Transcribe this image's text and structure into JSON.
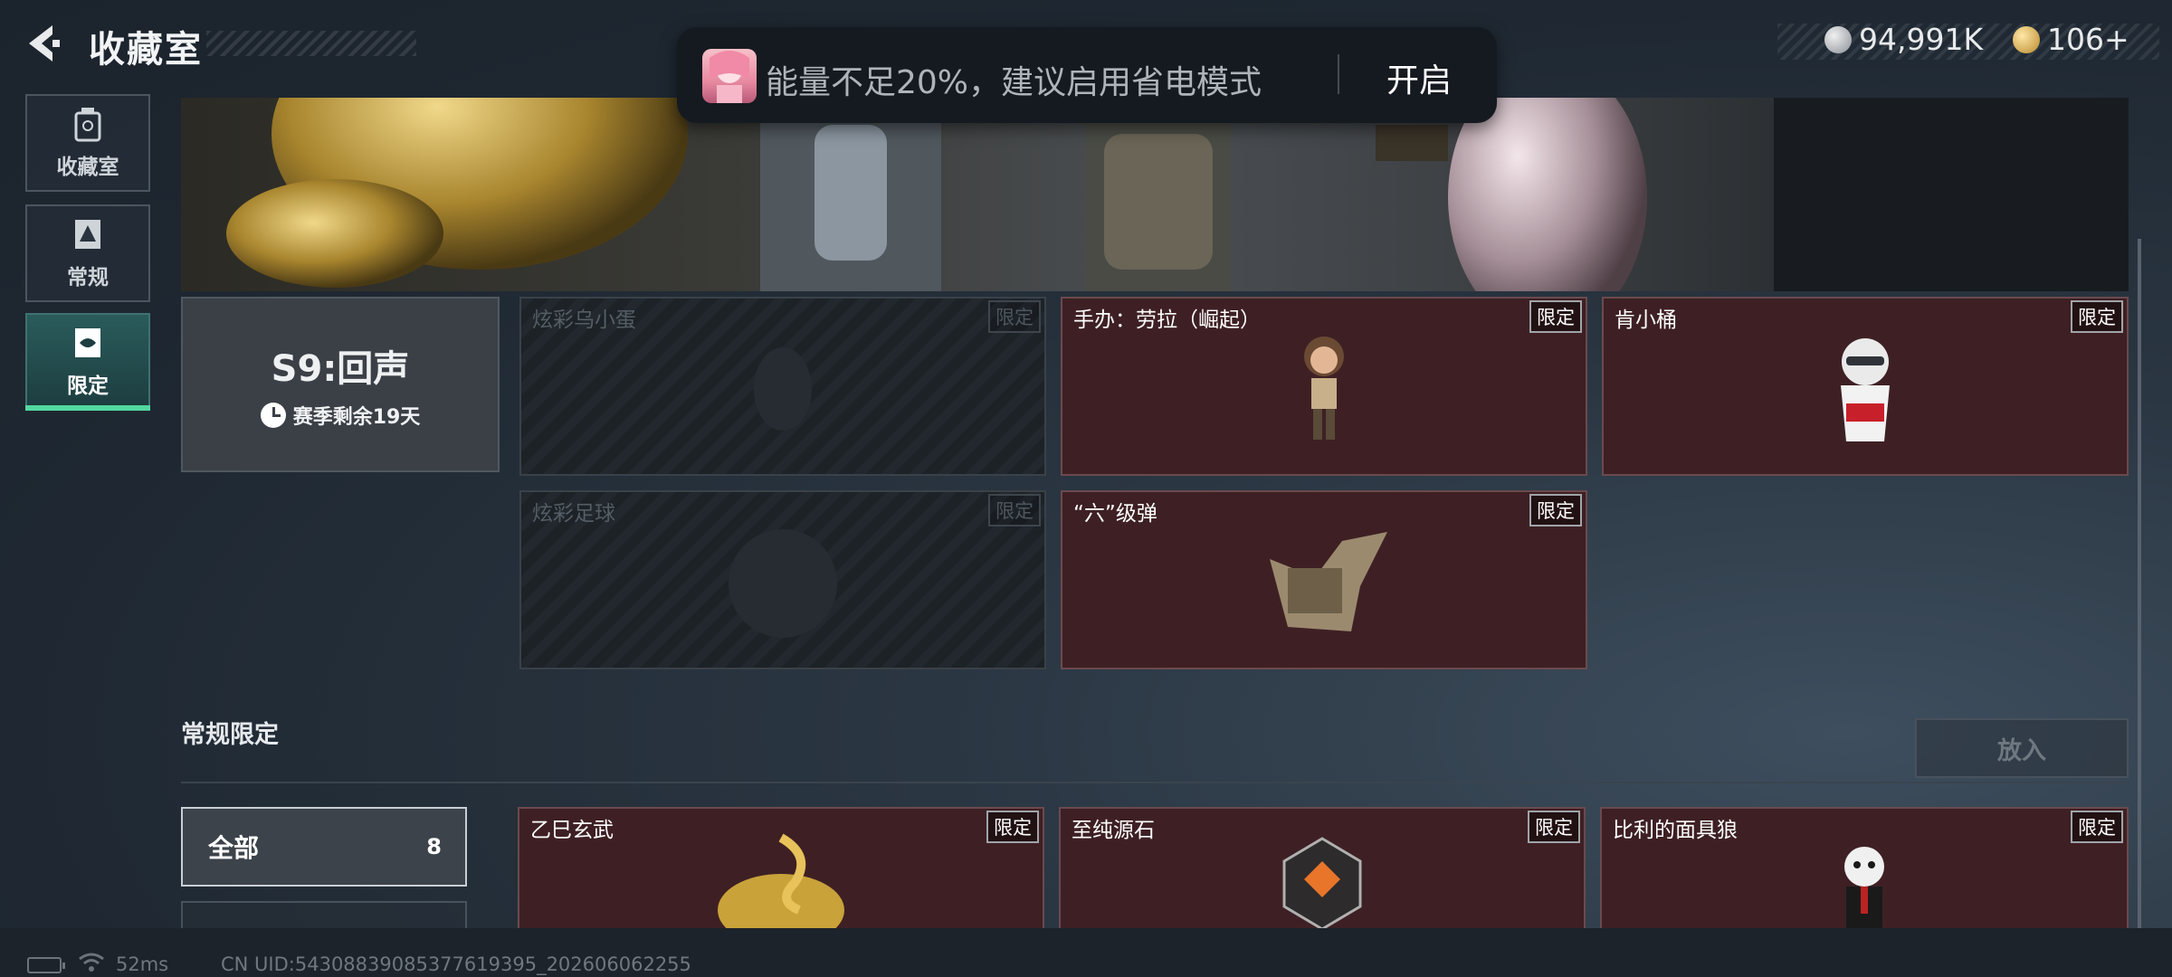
{
  "header": {
    "title": "收藏室",
    "currencies": [
      {
        "icon": "silver-coin-icon",
        "value": "94,991K"
      },
      {
        "icon": "gold-coin-icon",
        "value": "106+"
      }
    ]
  },
  "toast": {
    "message": "能量不足20%，建议启用省电模式",
    "action": "开启"
  },
  "sidebar": {
    "items": [
      {
        "label": "收藏室",
        "icon": "trash-bin-icon",
        "active": false
      },
      {
        "label": "常规",
        "icon": "document-icon",
        "active": false
      },
      {
        "label": "限定",
        "icon": "tag-icon",
        "active": true
      }
    ]
  },
  "season": {
    "title": "S9:回声",
    "remaining": "赛季剩余19天"
  },
  "limited_items": [
    {
      "name": "炫彩乌小蛋",
      "tag": "限定",
      "locked": true
    },
    {
      "name": "手办：劳拉（崛起）",
      "tag": "限定",
      "locked": false
    },
    {
      "name": "肯小桶",
      "tag": "限定",
      "locked": false
    },
    {
      "name": "炫彩足球",
      "tag": "限定",
      "locked": true
    },
    {
      "name": "“六”级弹",
      "tag": "限定",
      "locked": false
    }
  ],
  "regular_section": {
    "title": "常规限定",
    "put_button": "放入",
    "filters": [
      {
        "label": "全部",
        "count": "8"
      }
    ],
    "items": [
      {
        "name": "乙巳玄武",
        "tag": "限定"
      },
      {
        "name": "至纯源石",
        "tag": "限定"
      },
      {
        "name": "比利的面具狼",
        "tag": "限定"
      }
    ]
  },
  "status_bar": {
    "ping": "52ms",
    "uid": "CN UID:5430883908537761939​5_202606062255"
  },
  "colors": {
    "accent": "#53d8a0",
    "card_red": "#3e2024",
    "background": "#1f2832"
  }
}
